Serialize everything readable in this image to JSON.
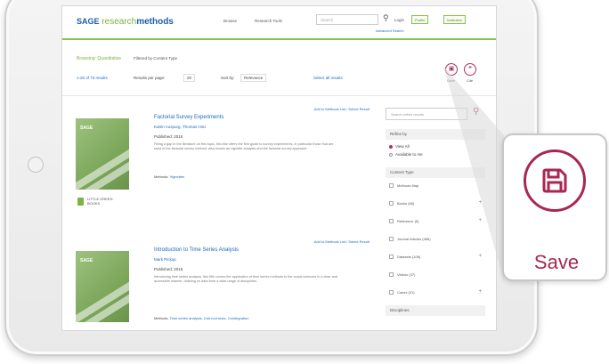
{
  "header": {
    "logo_sage": "SAGE",
    "logo_research": "research",
    "logo_methods": "methods",
    "nav": [
      "Browse",
      "Research Tools"
    ],
    "search_placeholder": "Search",
    "advanced_search": "Advanced Search",
    "login": "Login",
    "btn_profile": "Profile",
    "btn_institution": "Institution"
  },
  "toolbar": {
    "browse_title": "Browsing: Quantitative",
    "filter": "Filtered by Content Type",
    "result_count": "1-20 of 73 results",
    "results_per_page_label": "Results per page:",
    "results_per_page_value": "20",
    "sort_label": "Sort by:",
    "sort_value": "Relevance",
    "select_all": "Select all results",
    "save_label": "Save",
    "cite_label": "Cite"
  },
  "results": [
    {
      "add_link": "Add to Methods List / Select Result",
      "cover_title": "SAGE",
      "title": "Factorial Survey Experiments",
      "author": "Katrin Auspurg, Thomas Hinz",
      "published": "Published: 2015",
      "description": "Filling a gap in the literature on this topic, this title offers the first guide to survey experiments, in particular those that are used in the factorial survey method, also known as vignette analysis and the factorial survey approach.",
      "methods_label": "Methods:",
      "methods": "Vignettes",
      "type_label": "LITTLE GREEN BOOKS"
    },
    {
      "add_link": "Add to Methods List / Select Result",
      "cover_title": "SAGE",
      "title": "Introduction to Time Series Analysis",
      "author": "Mark Pickup",
      "published": "Published: 2015",
      "description": "Introducing time series analysis, this title covers the application of time series methods to the social sciences in a clear and accessible manner, drawing on data from a wide range of disciplines.",
      "methods_label": "Methods:",
      "methods": "Time series analysis, Unit root tests, Cointegration",
      "type_label": ""
    }
  ],
  "sidebar": {
    "search_placeholder": "Search within results",
    "refine_heading": "Refine by",
    "radio_all": "View All",
    "radio_available": "Available to me",
    "content_type_heading": "Content Type",
    "items": [
      "Methods Map",
      "Books (66)",
      "Reference (5)",
      "Journal Articles (466)",
      "Datasets (108)",
      "Videos (37)",
      "Cases (21)"
    ],
    "disciplines_heading": "Disciplines"
  },
  "callout": {
    "label": "Save",
    "icon": "floppy-disk-icon",
    "accent_color": "#a72850"
  }
}
